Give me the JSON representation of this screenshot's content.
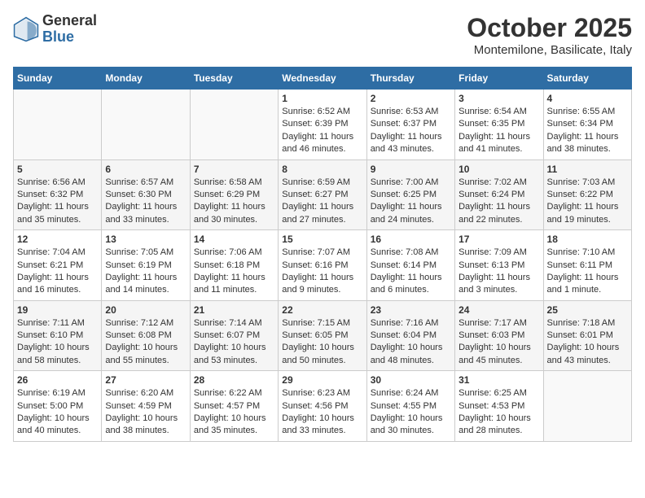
{
  "header": {
    "logo_general": "General",
    "logo_blue": "Blue",
    "month": "October 2025",
    "location": "Montemilone, Basilicate, Italy"
  },
  "days_of_week": [
    "Sunday",
    "Monday",
    "Tuesday",
    "Wednesday",
    "Thursday",
    "Friday",
    "Saturday"
  ],
  "weeks": [
    [
      {
        "day": "",
        "info": ""
      },
      {
        "day": "",
        "info": ""
      },
      {
        "day": "",
        "info": ""
      },
      {
        "day": "1",
        "info": "Sunrise: 6:52 AM\nSunset: 6:39 PM\nDaylight: 11 hours and 46 minutes."
      },
      {
        "day": "2",
        "info": "Sunrise: 6:53 AM\nSunset: 6:37 PM\nDaylight: 11 hours and 43 minutes."
      },
      {
        "day": "3",
        "info": "Sunrise: 6:54 AM\nSunset: 6:35 PM\nDaylight: 11 hours and 41 minutes."
      },
      {
        "day": "4",
        "info": "Sunrise: 6:55 AM\nSunset: 6:34 PM\nDaylight: 11 hours and 38 minutes."
      }
    ],
    [
      {
        "day": "5",
        "info": "Sunrise: 6:56 AM\nSunset: 6:32 PM\nDaylight: 11 hours and 35 minutes."
      },
      {
        "day": "6",
        "info": "Sunrise: 6:57 AM\nSunset: 6:30 PM\nDaylight: 11 hours and 33 minutes."
      },
      {
        "day": "7",
        "info": "Sunrise: 6:58 AM\nSunset: 6:29 PM\nDaylight: 11 hours and 30 minutes."
      },
      {
        "day": "8",
        "info": "Sunrise: 6:59 AM\nSunset: 6:27 PM\nDaylight: 11 hours and 27 minutes."
      },
      {
        "day": "9",
        "info": "Sunrise: 7:00 AM\nSunset: 6:25 PM\nDaylight: 11 hours and 24 minutes."
      },
      {
        "day": "10",
        "info": "Sunrise: 7:02 AM\nSunset: 6:24 PM\nDaylight: 11 hours and 22 minutes."
      },
      {
        "day": "11",
        "info": "Sunrise: 7:03 AM\nSunset: 6:22 PM\nDaylight: 11 hours and 19 minutes."
      }
    ],
    [
      {
        "day": "12",
        "info": "Sunrise: 7:04 AM\nSunset: 6:21 PM\nDaylight: 11 hours and 16 minutes."
      },
      {
        "day": "13",
        "info": "Sunrise: 7:05 AM\nSunset: 6:19 PM\nDaylight: 11 hours and 14 minutes."
      },
      {
        "day": "14",
        "info": "Sunrise: 7:06 AM\nSunset: 6:18 PM\nDaylight: 11 hours and 11 minutes."
      },
      {
        "day": "15",
        "info": "Sunrise: 7:07 AM\nSunset: 6:16 PM\nDaylight: 11 hours and 9 minutes."
      },
      {
        "day": "16",
        "info": "Sunrise: 7:08 AM\nSunset: 6:14 PM\nDaylight: 11 hours and 6 minutes."
      },
      {
        "day": "17",
        "info": "Sunrise: 7:09 AM\nSunset: 6:13 PM\nDaylight: 11 hours and 3 minutes."
      },
      {
        "day": "18",
        "info": "Sunrise: 7:10 AM\nSunset: 6:11 PM\nDaylight: 11 hours and 1 minute."
      }
    ],
    [
      {
        "day": "19",
        "info": "Sunrise: 7:11 AM\nSunset: 6:10 PM\nDaylight: 10 hours and 58 minutes."
      },
      {
        "day": "20",
        "info": "Sunrise: 7:12 AM\nSunset: 6:08 PM\nDaylight: 10 hours and 55 minutes."
      },
      {
        "day": "21",
        "info": "Sunrise: 7:14 AM\nSunset: 6:07 PM\nDaylight: 10 hours and 53 minutes."
      },
      {
        "day": "22",
        "info": "Sunrise: 7:15 AM\nSunset: 6:05 PM\nDaylight: 10 hours and 50 minutes."
      },
      {
        "day": "23",
        "info": "Sunrise: 7:16 AM\nSunset: 6:04 PM\nDaylight: 10 hours and 48 minutes."
      },
      {
        "day": "24",
        "info": "Sunrise: 7:17 AM\nSunset: 6:03 PM\nDaylight: 10 hours and 45 minutes."
      },
      {
        "day": "25",
        "info": "Sunrise: 7:18 AM\nSunset: 6:01 PM\nDaylight: 10 hours and 43 minutes."
      }
    ],
    [
      {
        "day": "26",
        "info": "Sunrise: 6:19 AM\nSunset: 5:00 PM\nDaylight: 10 hours and 40 minutes."
      },
      {
        "day": "27",
        "info": "Sunrise: 6:20 AM\nSunset: 4:59 PM\nDaylight: 10 hours and 38 minutes."
      },
      {
        "day": "28",
        "info": "Sunrise: 6:22 AM\nSunset: 4:57 PM\nDaylight: 10 hours and 35 minutes."
      },
      {
        "day": "29",
        "info": "Sunrise: 6:23 AM\nSunset: 4:56 PM\nDaylight: 10 hours and 33 minutes."
      },
      {
        "day": "30",
        "info": "Sunrise: 6:24 AM\nSunset: 4:55 PM\nDaylight: 10 hours and 30 minutes."
      },
      {
        "day": "31",
        "info": "Sunrise: 6:25 AM\nSunset: 4:53 PM\nDaylight: 10 hours and 28 minutes."
      },
      {
        "day": "",
        "info": ""
      }
    ]
  ]
}
